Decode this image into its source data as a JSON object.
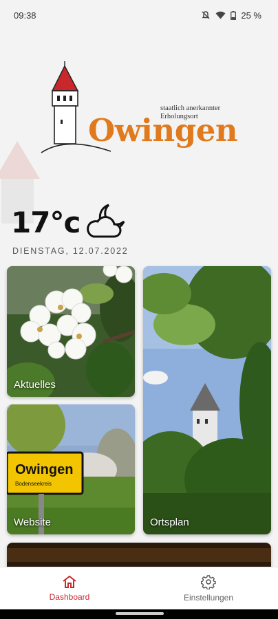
{
  "status_bar": {
    "time": "09:38",
    "battery": "25 %",
    "icons": [
      "mute-icon",
      "wifi-icon",
      "battery-icon"
    ]
  },
  "logo": {
    "subtitle_line1": "staatlich anerkannter",
    "subtitle_line2": "Erholungsort",
    "name": "Owingen",
    "brand_color": "#e07a1c",
    "tower_roof_color": "#c8282c"
  },
  "weather": {
    "temperature": "17°c",
    "icon": "cloud-moon-icon",
    "date": "DIENSTAG, 12.07.2022"
  },
  "tiles": {
    "aktuelles": {
      "label": "Aktuelles"
    },
    "website": {
      "label": "Website",
      "sign_text": "Owingen",
      "sign_subtext": "Bodenseekreis"
    },
    "ortsplan": {
      "label": "Ortsplan"
    }
  },
  "bottom_nav": {
    "dashboard": {
      "label": "Dashboard",
      "icon": "home-icon",
      "active": true
    },
    "settings": {
      "label": "Einstellungen",
      "icon": "gear-icon",
      "active": false
    }
  },
  "colors": {
    "accent": "#c8282c",
    "background": "#f3f3f3"
  }
}
